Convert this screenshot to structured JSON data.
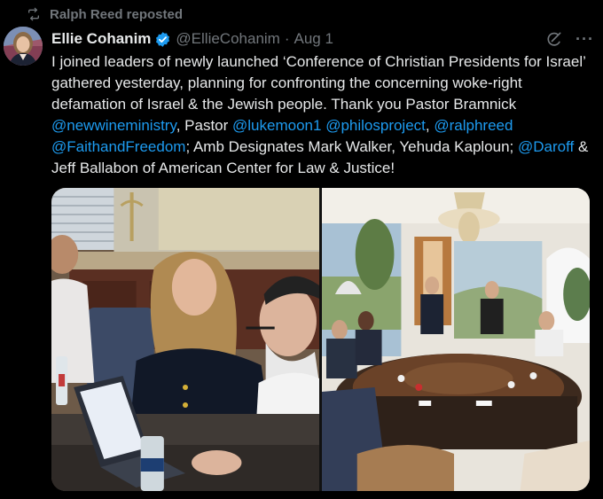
{
  "repost": {
    "icon": "repost-icon",
    "text": "Ralph Reed reposted"
  },
  "author": {
    "name": "Ellie Cohanim",
    "handle": "@EllieCohanim",
    "separator": "·",
    "date": "Aug 1",
    "verified": true,
    "verified_color": "#1d9bf0"
  },
  "actions": {
    "grok_icon": "grok-icon",
    "more_label": "···"
  },
  "tweet": {
    "t1": "I joined leaders of newly launched ‘Conference of Christian Presidents for Israel’ gathered yesterday, planning for confronting the concerning woke-right defamation of Israel & the Jewish people. Thank you Pastor Bramnick ",
    "m1": "@newwineministry",
    "t2": ", Pastor ",
    "m2": "@lukemoon1",
    "t3": " ",
    "m3": "@philosproject",
    "t4": ", ",
    "m4": "@ralphreed",
    "t5": " ",
    "m5": "@FaithandFreedom",
    "t6": "; Amb Designates Mark Walker, Yehuda Kaploun; ",
    "m6": "@Daroff",
    "t7": " & Jeff Ballabon of American Center for Law & Justice!"
  },
  "media": {
    "photos": [
      {
        "icon": "meeting-photo-closeup"
      },
      {
        "icon": "meeting-photo-roundtable"
      }
    ]
  },
  "colors": {
    "background": "#000000",
    "text": "#e7e9ea",
    "muted": "#71767b",
    "link": "#1d9bf0"
  }
}
